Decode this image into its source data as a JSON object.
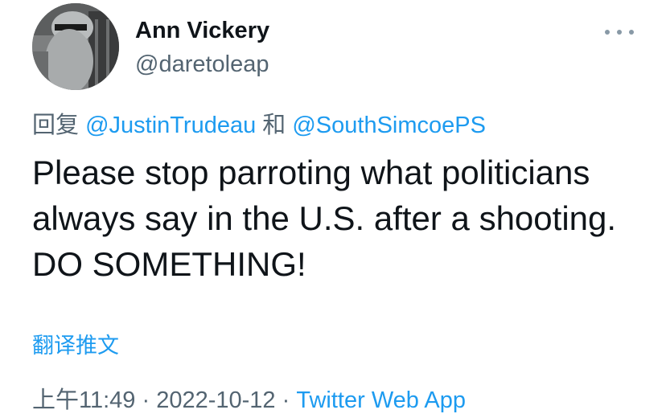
{
  "author": {
    "name": "Ann Vickery",
    "handle": "@daretoleap"
  },
  "reply_line": {
    "prefix": "回复",
    "mention_1": "@JustinTrudeau",
    "conjunction": "和",
    "mention_2": "@SouthSimcoePS"
  },
  "tweet": {
    "text": "Please stop parroting what politicians always say in the U.S. after a shooting. DO SOMETHING!"
  },
  "actions": {
    "translate_label": "翻译推文",
    "more_icon": "more-horizontal-icon"
  },
  "meta": {
    "time": "上午11:49",
    "separator": "·",
    "date": "2022-10-12",
    "source": "Twitter Web App"
  },
  "colors": {
    "link": "#1d9bf0",
    "secondary_text": "#536471",
    "primary_text": "#0f1419"
  }
}
